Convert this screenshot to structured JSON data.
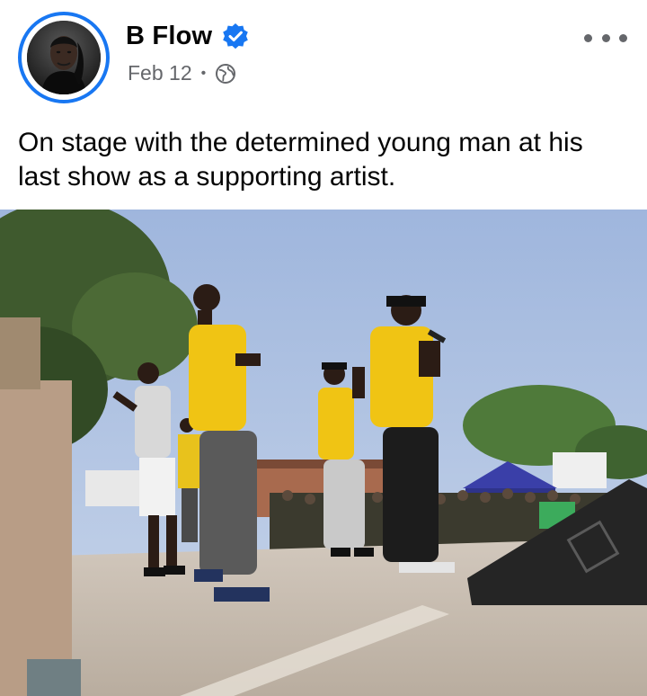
{
  "post": {
    "author_name": "B Flow",
    "verified_icon": "verified-badge-icon",
    "date": "Feb 12",
    "separator": "•",
    "audience_icon": "globe-icon",
    "more_icon": "more-options-icon",
    "caption": "On stage with the determined young man at his last show as a supporting artist."
  },
  "colors": {
    "accent": "#1877f2",
    "secondary_text": "#65676b",
    "primary_text": "#050505"
  }
}
